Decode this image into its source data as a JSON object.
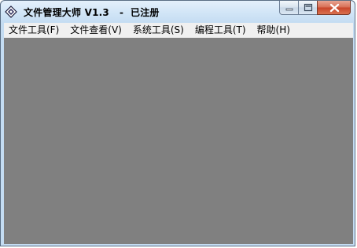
{
  "window": {
    "title": "文件管理大师 V1.3   -  已注册",
    "app_icon": "diamond-app-icon"
  },
  "caption_buttons": {
    "minimize_icon": "minimize-icon",
    "maximize_icon": "maximize-icon",
    "close_icon": "close-icon"
  },
  "menu": {
    "items": [
      {
        "label": "文件工具(F)"
      },
      {
        "label": "文件查看(V)"
      },
      {
        "label": "系统工具(S)"
      },
      {
        "label": "编程工具(T)"
      },
      {
        "label": "帮助(H)"
      }
    ]
  },
  "colors": {
    "client_area": "#808080",
    "close_button": "#c8452a",
    "titlebar": "#c4dcf2"
  }
}
